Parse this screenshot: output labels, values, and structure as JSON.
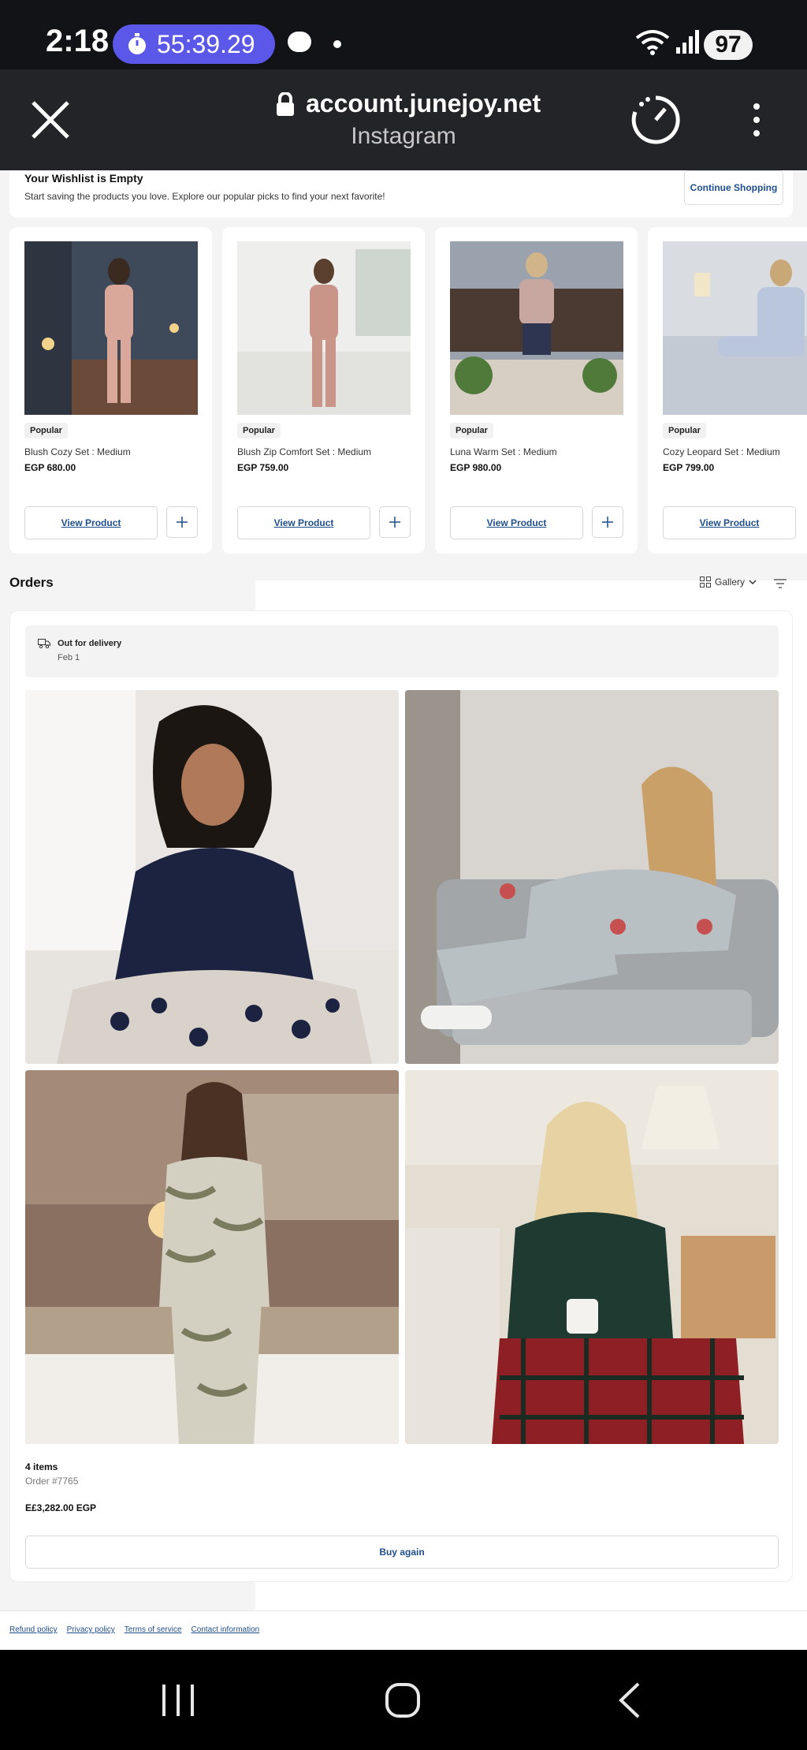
{
  "status_bar": {
    "time": "2:18",
    "timer": "55:39.29",
    "battery": "97"
  },
  "browser": {
    "url": "account.junejoy.net",
    "subtitle": "Instagram"
  },
  "wishlist": {
    "title": "Your Wishlist is Empty",
    "description": "Start saving the products you love. Explore our popular picks to find your next favorite!",
    "cta": "Continue Shopping"
  },
  "products": [
    {
      "badge": "Popular",
      "name": "Blush Cozy Set : Medium",
      "price": "EGP 680.00",
      "button": "View Product"
    },
    {
      "badge": "Popular",
      "name": "Blush Zip Comfort Set : Medium",
      "price": "EGP 759.00",
      "button": "View Product"
    },
    {
      "badge": "Popular",
      "name": "Luna Warm Set : Medium",
      "price": "EGP 980.00",
      "button": "View Product"
    },
    {
      "badge": "Popular",
      "name": "Cozy Leopard Set : Medium",
      "price": "EGP 799.00",
      "button": "View Product"
    }
  ],
  "orders": {
    "title": "Orders",
    "view_label": "Gallery",
    "order": {
      "status": "Out for delivery",
      "date": "Feb 1",
      "items_count": "4 items",
      "order_number": "Order #7765",
      "total": "E£3,282.00 EGP",
      "action": "Buy again"
    }
  },
  "footer": {
    "links": [
      "Refund policy",
      "Privacy policy",
      "Terms of service",
      "Contact information"
    ]
  },
  "colors": {
    "accent_link": "#1f4e8c",
    "timer_pill": "#5b57e8",
    "browser_bar": "#222428"
  }
}
